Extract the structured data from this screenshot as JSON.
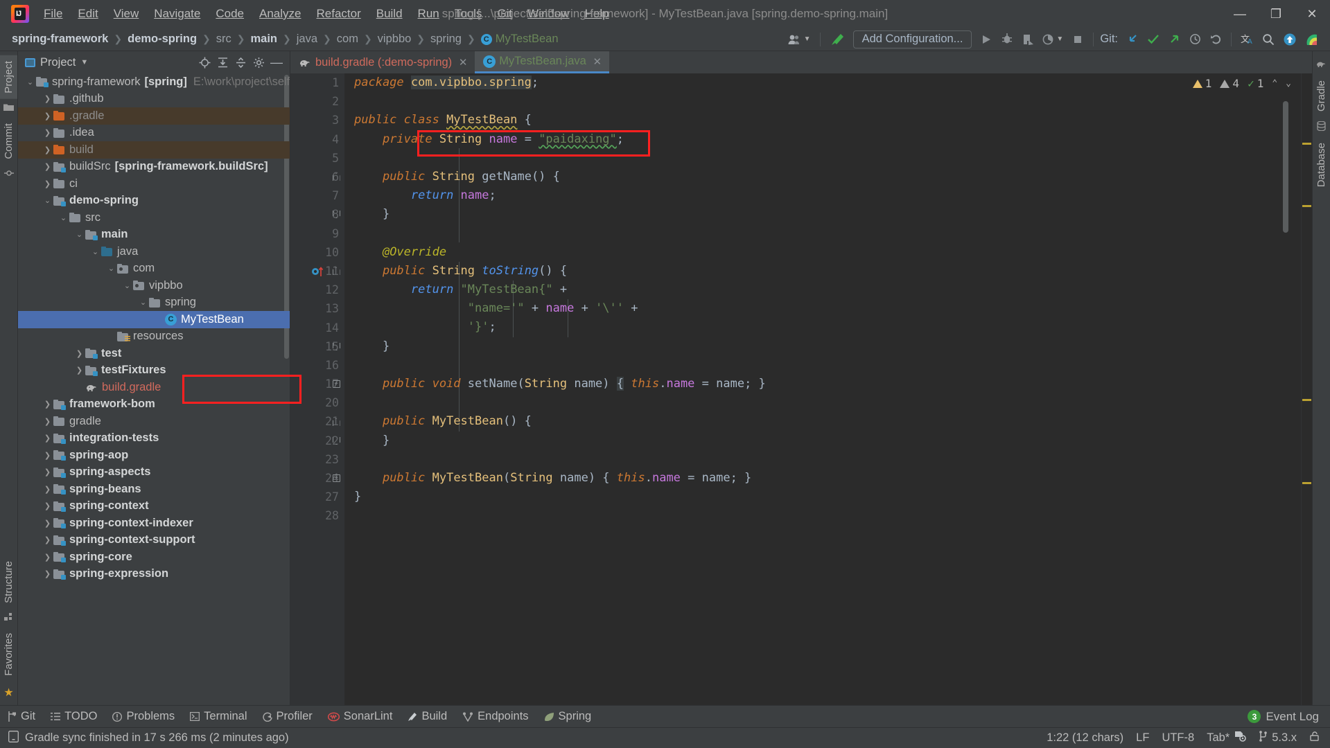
{
  "window": {
    "title": "spring [...\\project\\self\\spring-framework] - MyTestBean.java [spring.demo-spring.main]",
    "minimize": "—",
    "maximize": "❐",
    "close": "✕"
  },
  "menubar": {
    "items": [
      {
        "label": "File"
      },
      {
        "label": "Edit"
      },
      {
        "label": "View"
      },
      {
        "label": "Navigate"
      },
      {
        "label": "Code"
      },
      {
        "label": "Analyze"
      },
      {
        "label": "Refactor"
      },
      {
        "label": "Build"
      },
      {
        "label": "Run"
      },
      {
        "label": "Tools"
      },
      {
        "label": "Git"
      },
      {
        "label": "Window"
      },
      {
        "label": "Help"
      }
    ]
  },
  "navbar": {
    "breadcrumbs": [
      {
        "label": "spring-framework",
        "style": "bold"
      },
      {
        "label": "demo-spring",
        "style": "bold"
      },
      {
        "label": "src",
        "style": "dim"
      },
      {
        "label": "main",
        "style": "bold"
      },
      {
        "label": "java",
        "style": "dim"
      },
      {
        "label": "com",
        "style": "dim"
      },
      {
        "label": "spring",
        "style": "dim"
      },
      {
        "label": "MyTestBean",
        "style": "class"
      }
    ],
    "vipbbo": "vipbbo",
    "add_configuration": "Add Configuration...",
    "git_label": "Git:",
    "icons": {
      "profile": "profile-icon",
      "build_hammer": "build-hammer-icon",
      "run": "run-icon",
      "debug": "debug-icon",
      "run_coverage": "run-with-coverage-icon",
      "profile_run": "profiler-run-icon",
      "stop": "stop-icon",
      "update": "git-update-icon",
      "commit": "git-commit-icon",
      "push": "git-push-icon",
      "history": "git-history-icon",
      "rollback": "git-rollback-icon",
      "translate": "translate-icon",
      "search": "search-everywhere-icon",
      "upload": "upload-icon",
      "rainbow": "rainbow-icon"
    }
  },
  "left_rail": {
    "items": [
      {
        "label": "Project",
        "active": true
      },
      {
        "label": "Commit",
        "active": false
      },
      {
        "label": "Structure",
        "active": false
      },
      {
        "label": "Favorites",
        "active": false
      }
    ]
  },
  "right_rail": {
    "items": [
      {
        "label": "Gradle"
      },
      {
        "label": "Database"
      }
    ]
  },
  "project_panel": {
    "title": "Project",
    "tools": [
      {
        "name": "locate-icon",
        "glyph": "⊕"
      },
      {
        "name": "expand-all-icon",
        "glyph": "⤒"
      },
      {
        "name": "collapse-all-icon",
        "glyph": "⤓"
      },
      {
        "name": "settings-gear-icon",
        "glyph": "⚙"
      },
      {
        "name": "hide-icon",
        "glyph": "—"
      }
    ],
    "tree": [
      {
        "label": "spring-framework",
        "suffix": "[spring]",
        "path": "E:\\work\\project\\self",
        "indent": 0,
        "arrow": "down",
        "icon": "module",
        "bold": false
      },
      {
        "label": ".github",
        "indent": 1,
        "arrow": "right",
        "icon": "folder"
      },
      {
        "label": ".gradle",
        "indent": 1,
        "arrow": "right",
        "icon": "folder-orange",
        "row": "gradle",
        "dim": true
      },
      {
        "label": ".idea",
        "indent": 1,
        "arrow": "right",
        "icon": "folder"
      },
      {
        "label": "build",
        "indent": 1,
        "arrow": "right",
        "icon": "folder-orange",
        "row": "gradle",
        "dim": true
      },
      {
        "label": "buildSrc",
        "suffix": "[spring-framework.buildSrc]",
        "indent": 1,
        "arrow": "right",
        "icon": "module"
      },
      {
        "label": "ci",
        "indent": 1,
        "arrow": "right",
        "icon": "folder"
      },
      {
        "label": "demo-spring",
        "indent": 1,
        "arrow": "down",
        "icon": "module",
        "bold": true
      },
      {
        "label": "src",
        "indent": 2,
        "arrow": "down",
        "icon": "folder"
      },
      {
        "label": "main",
        "indent": 3,
        "arrow": "down",
        "icon": "module",
        "bold": true
      },
      {
        "label": "java",
        "indent": 4,
        "arrow": "down",
        "icon": "folder-blue"
      },
      {
        "label": "com",
        "indent": 5,
        "arrow": "down",
        "icon": "package"
      },
      {
        "label": "vipbbo",
        "indent": 6,
        "arrow": "down",
        "icon": "package"
      },
      {
        "label": "spring",
        "indent": 7,
        "arrow": "down",
        "icon": "module"
      },
      {
        "label": "MyTestBean",
        "indent": 8,
        "arrow": "none",
        "icon": "class",
        "selected": true
      },
      {
        "label": "resources",
        "indent": 4,
        "arrow": "none",
        "icon": "resources"
      },
      {
        "label": "test",
        "indent": 3,
        "arrow": "right",
        "icon": "module",
        "bold": true
      },
      {
        "label": "testFixtures",
        "indent": 3,
        "arrow": "right",
        "icon": "module",
        "bold": true
      },
      {
        "label": "build.gradle",
        "indent": 3,
        "arrow": "none",
        "icon": "gradle",
        "red": true
      },
      {
        "label": "framework-bom",
        "indent": 1,
        "arrow": "right",
        "icon": "module",
        "bold": true
      },
      {
        "label": "gradle",
        "indent": 1,
        "arrow": "right",
        "icon": "folder"
      },
      {
        "label": "integration-tests",
        "indent": 1,
        "arrow": "right",
        "icon": "module",
        "bold": true
      },
      {
        "label": "spring-aop",
        "indent": 1,
        "arrow": "right",
        "icon": "module",
        "bold": true
      },
      {
        "label": "spring-aspects",
        "indent": 1,
        "arrow": "right",
        "icon": "module",
        "bold": true
      },
      {
        "label": "spring-beans",
        "indent": 1,
        "arrow": "right",
        "icon": "module",
        "bold": true
      },
      {
        "label": "spring-context",
        "indent": 1,
        "arrow": "right",
        "icon": "module",
        "bold": true
      },
      {
        "label": "spring-context-indexer",
        "indent": 1,
        "arrow": "right",
        "icon": "module",
        "bold": true
      },
      {
        "label": "spring-context-support",
        "indent": 1,
        "arrow": "right",
        "icon": "module",
        "bold": true
      },
      {
        "label": "spring-core",
        "indent": 1,
        "arrow": "right",
        "icon": "module",
        "bold": true
      },
      {
        "label": "spring-expression",
        "indent": 1,
        "arrow": "right",
        "icon": "module",
        "bold": true
      }
    ]
  },
  "editor": {
    "tabs": [
      {
        "label": "build.gradle (:demo-spring)",
        "icon": "gradle-icon",
        "active": false,
        "closable": true
      },
      {
        "label": "MyTestBean.java",
        "icon": "class-icon",
        "active": true,
        "closable": true
      }
    ],
    "inspections": {
      "warnings": "1",
      "weak_warnings": "4",
      "checks": "1"
    },
    "line_numbers": [
      "1",
      "2",
      "3",
      "4",
      "5",
      "6",
      "7",
      "8",
      "9",
      "10",
      "11",
      "12",
      "13",
      "14",
      "15",
      "16",
      "17",
      "20",
      "21",
      "22",
      "23",
      "24",
      "27",
      "28"
    ],
    "lines": [
      {
        "num": "1",
        "tokens": [
          {
            "t": "package ",
            "c": "ki"
          },
          {
            "t": "com.vipbbo.spring",
            "c": "ty hl"
          },
          {
            "t": ";",
            "c": "pl"
          }
        ]
      },
      {
        "num": "2",
        "tokens": []
      },
      {
        "num": "3",
        "tokens": [
          {
            "t": "public class ",
            "c": "ki"
          },
          {
            "t": "MyTestBean",
            "c": "ty squiggle-y"
          },
          {
            "t": " {",
            "c": "pl"
          }
        ]
      },
      {
        "num": "4",
        "tokens": [
          {
            "t": "    private ",
            "c": "ki"
          },
          {
            "t": "String",
            "c": "ty"
          },
          {
            "t": " ",
            "c": "pl"
          },
          {
            "t": "name",
            "c": "fld"
          },
          {
            "t": " = ",
            "c": "pl"
          },
          {
            "t": "\"paidaxing\"",
            "c": "st squiggle-g"
          },
          {
            "t": ";",
            "c": "pl"
          }
        ]
      },
      {
        "num": "5",
        "tokens": []
      },
      {
        "num": "6",
        "tokens": [
          {
            "t": "    public ",
            "c": "ki"
          },
          {
            "t": "String",
            "c": "ty"
          },
          {
            "t": " ",
            "c": "pl"
          },
          {
            "t": "getName",
            "c": "mth"
          },
          {
            "t": "() {",
            "c": "pl"
          }
        ]
      },
      {
        "num": "7",
        "tokens": [
          {
            "t": "        return ",
            "c": "kb"
          },
          {
            "t": "name",
            "c": "fld"
          },
          {
            "t": ";",
            "c": "pl"
          }
        ]
      },
      {
        "num": "8",
        "tokens": [
          {
            "t": "    }",
            "c": "pl"
          }
        ]
      },
      {
        "num": "9",
        "tokens": []
      },
      {
        "num": "10",
        "tokens": [
          {
            "t": "    @Override",
            "c": "an"
          }
        ]
      },
      {
        "num": "11",
        "tokens": [
          {
            "t": "    public ",
            "c": "ki"
          },
          {
            "t": "String",
            "c": "ty"
          },
          {
            "t": " ",
            "c": "pl"
          },
          {
            "t": "toString",
            "c": "kb"
          },
          {
            "t": "() {",
            "c": "pl"
          }
        ]
      },
      {
        "num": "12",
        "tokens": [
          {
            "t": "        return ",
            "c": "kb"
          },
          {
            "t": "\"MyTestBean{\"",
            "c": "st"
          },
          {
            "t": " +",
            "c": "pl"
          }
        ]
      },
      {
        "num": "13",
        "tokens": [
          {
            "t": "                \"name='\"",
            "c": "st"
          },
          {
            "t": " + ",
            "c": "pl"
          },
          {
            "t": "name",
            "c": "fld"
          },
          {
            "t": " + ",
            "c": "pl"
          },
          {
            "t": "'\\''",
            "c": "st"
          },
          {
            "t": " +",
            "c": "pl"
          }
        ]
      },
      {
        "num": "14",
        "tokens": [
          {
            "t": "                '}'",
            "c": "st"
          },
          {
            "t": ";",
            "c": "pl"
          }
        ]
      },
      {
        "num": "15",
        "tokens": [
          {
            "t": "    }",
            "c": "pl"
          }
        ]
      },
      {
        "num": "16",
        "tokens": []
      },
      {
        "num": "17",
        "tokens": [
          {
            "t": "    public void ",
            "c": "ki"
          },
          {
            "t": "setName",
            "c": "mth"
          },
          {
            "t": "(",
            "c": "pl"
          },
          {
            "t": "String",
            "c": "ty"
          },
          {
            "t": " name) ",
            "c": "pl"
          },
          {
            "t": "{",
            "c": "pl hl"
          },
          {
            "t": " ",
            "c": "pl"
          },
          {
            "t": "this",
            "c": "this"
          },
          {
            "t": ".",
            "c": "pl"
          },
          {
            "t": "name",
            "c": "fld"
          },
          {
            "t": " = name; }",
            "c": "pl"
          }
        ]
      },
      {
        "num": "20",
        "tokens": []
      },
      {
        "num": "21",
        "tokens": [
          {
            "t": "    public ",
            "c": "ki"
          },
          {
            "t": "MyTestBean",
            "c": "ty"
          },
          {
            "t": "() {",
            "c": "pl"
          }
        ]
      },
      {
        "num": "22",
        "tokens": [
          {
            "t": "    }",
            "c": "pl"
          }
        ]
      },
      {
        "num": "23",
        "tokens": []
      },
      {
        "num": "24",
        "tokens": [
          {
            "t": "    public ",
            "c": "ki"
          },
          {
            "t": "MyTestBean",
            "c": "ty"
          },
          {
            "t": "(",
            "c": "pl"
          },
          {
            "t": "String",
            "c": "ty"
          },
          {
            "t": " name) { ",
            "c": "pl"
          },
          {
            "t": "this",
            "c": "this"
          },
          {
            "t": ".",
            "c": "pl"
          },
          {
            "t": "name",
            "c": "fld"
          },
          {
            "t": " = name; }",
            "c": "pl"
          }
        ]
      },
      {
        "num": "27",
        "tokens": [
          {
            "t": "}",
            "c": "pl"
          }
        ]
      },
      {
        "num": "28",
        "tokens": []
      }
    ]
  },
  "toolwindow_bar": {
    "items": [
      {
        "label": "Git",
        "icon": "git-branch-icon"
      },
      {
        "label": "TODO",
        "icon": "todo-list-icon"
      },
      {
        "label": "Problems",
        "icon": "problems-icon"
      },
      {
        "label": "Terminal",
        "icon": "terminal-icon"
      },
      {
        "label": "Profiler",
        "icon": "profiler-icon"
      },
      {
        "label": "SonarLint",
        "icon": "sonarlint-icon"
      },
      {
        "label": "Build",
        "icon": "build-icon"
      },
      {
        "label": "Endpoints",
        "icon": "endpoints-icon"
      },
      {
        "label": "Spring",
        "icon": "spring-leaf-icon"
      }
    ],
    "event_log": {
      "label": "Event Log",
      "count": "3"
    }
  },
  "statusbar": {
    "message": "Gradle sync finished in 17 s 266 ms (2 minutes ago)",
    "caret": "1:22 (12 chars)",
    "line_sep": "LF",
    "encoding": "UTF-8",
    "indent": "Tab*",
    "branch": "5.3.x",
    "lock_icon": "lock-icon",
    "inspect_icon": "inspection-icon"
  },
  "annotations": {
    "accent_red": "#ff2020",
    "box_code_class": "highlight on class declaration line",
    "box_tree_item": "highlight on MyTestBean tree node"
  }
}
